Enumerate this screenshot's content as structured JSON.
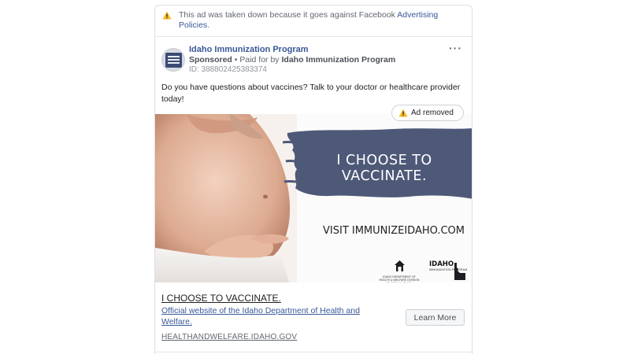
{
  "notice": {
    "text": "This ad was taken down because it goes against Facebook ",
    "link": "Advertising Policies",
    "suffix": ".",
    "icon": "warning-icon",
    "icon_color": "#f7b928"
  },
  "post": {
    "page_name": "Idaho Immunization Program",
    "sponsored_label": "Sponsored",
    "separator": " • ",
    "paid_for_prefix": "Paid for by ",
    "paid_for_by": "Idaho Immunization Program",
    "ad_id": "ID: 388802425383374",
    "more_label": "···",
    "body": "Do you have questions about vaccines? Talk to your doctor or healthcare provider today!"
  },
  "badge": {
    "label": "Ad removed",
    "icon": "warning-icon"
  },
  "creative": {
    "slogan": "I CHOOSE TO VACCINATE.",
    "visit": "VISIT IMMUNIZEIDAHO.COM",
    "dhw_logo_text": "IDAHO DEPARTMENT OF HEALTH & WELFARE DIVISION OF PUBLIC HEALTH",
    "iip_logo_title": "IDAHO",
    "iip_logo_sub": "IMMUNIZATION PROGRAM",
    "brush_color": "#4e5978"
  },
  "link_card": {
    "headline": "I CHOOSE TO VACCINATE.",
    "description": "Official website of the Idaho Department of Health and Welfare.",
    "domain": "HEALTHANDWELFARE.IDAHO.GOV",
    "cta": "Learn More"
  },
  "colors": {
    "link": "#385898",
    "muted": "#606770",
    "border": "#dddfe2"
  }
}
